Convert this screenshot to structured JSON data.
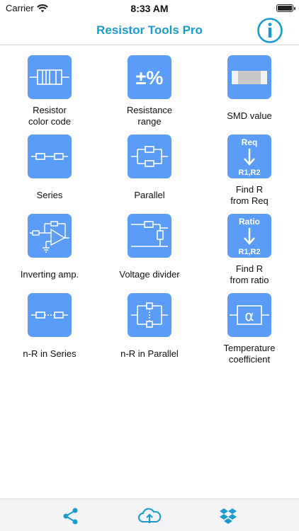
{
  "status_bar": {
    "carrier": "Carrier",
    "time": "8:33 AM"
  },
  "nav": {
    "title": "Resistor Tools Pro",
    "info_icon": "info-icon"
  },
  "accent_color": "#1a9bd0",
  "tile_color": "#5a9cf8",
  "tools": [
    {
      "label": "Resistor\ncolor code",
      "icon": "resistor-color-code-icon"
    },
    {
      "label": "Resistance\nrange",
      "icon": "plus-minus-percent-icon",
      "icon_text": "±%"
    },
    {
      "label": "SMD value",
      "icon": "smd-resistor-icon"
    },
    {
      "label": "Series",
      "icon": "series-resistors-icon"
    },
    {
      "label": "Parallel",
      "icon": "parallel-resistors-icon"
    },
    {
      "label": "Find R\nfrom Req",
      "icon": "find-r-from-req-icon",
      "icon_top": "Req",
      "icon_bottom": "R1,R2"
    },
    {
      "label": "Inverting amp.",
      "icon": "inverting-amplifier-icon"
    },
    {
      "label": "Voltage divider",
      "icon": "voltage-divider-icon"
    },
    {
      "label": "Find R\nfrom ratio",
      "icon": "find-r-from-ratio-icon",
      "icon_top": "Ratio",
      "icon_bottom": "R1,R2"
    },
    {
      "label": "n-R in Series",
      "icon": "n-resistors-series-icon"
    },
    {
      "label": "n-R in Parallel",
      "icon": "n-resistors-parallel-icon"
    },
    {
      "label": "Temperature\ncoefficient",
      "icon": "temperature-coefficient-icon",
      "icon_text": "α"
    }
  ],
  "toolbar": {
    "share_icon": "share-icon",
    "cloud_upload_icon": "cloud-upload-icon",
    "dropbox_icon": "dropbox-icon"
  }
}
